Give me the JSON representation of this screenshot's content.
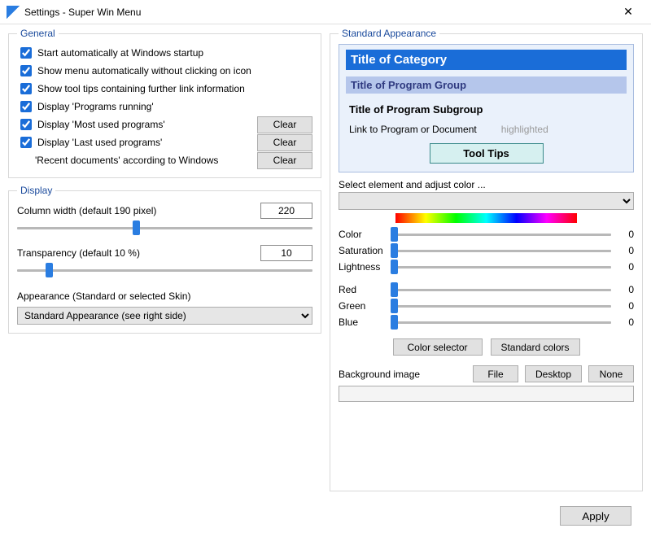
{
  "window": {
    "title": "Settings - Super Win Menu",
    "close": "✕"
  },
  "general": {
    "legend": "General",
    "items": [
      {
        "label": "Start automatically at Windows startup",
        "checked": true,
        "clear": false
      },
      {
        "label": "Show menu automatically without clicking on icon",
        "checked": true,
        "clear": false
      },
      {
        "label": "Show tool tips containing further link information",
        "checked": true,
        "clear": false
      },
      {
        "label": "Display 'Programs running'",
        "checked": true,
        "clear": false
      },
      {
        "label": "Display 'Most used programs'",
        "checked": true,
        "clear": true
      },
      {
        "label": "Display 'Last used programs'",
        "checked": true,
        "clear": true
      },
      {
        "label": "'Recent documents' according to Windows",
        "checked": null,
        "clear": true
      }
    ],
    "clear_label": "Clear"
  },
  "display": {
    "legend": "Display",
    "column_width_label": "Column width  (default 190 pixel)",
    "column_width_value": "220",
    "transparency_label": "Transparency  (default 10 %)",
    "transparency_value": "10",
    "appearance_label": "Appearance (Standard or selected Skin)",
    "appearance_value": "Standard Appearance (see right side)"
  },
  "standard": {
    "legend": "Standard Appearance",
    "preview": {
      "category": "Title of Category",
      "group": "Title of Program Group",
      "subgroup": "Title of Program Subgroup",
      "link": "Link to Program or Document",
      "highlighted": "highlighted",
      "tooltip": "Tool Tips"
    },
    "select_label": "Select element and adjust color ...",
    "select_value": "",
    "sliders": {
      "color": {
        "label": "Color",
        "value": "0"
      },
      "saturation": {
        "label": "Saturation",
        "value": "0"
      },
      "lightness": {
        "label": "Lightness",
        "value": "0"
      },
      "red": {
        "label": "Red",
        "value": "0"
      },
      "green": {
        "label": "Green",
        "value": "0"
      },
      "blue": {
        "label": "Blue",
        "value": "0"
      }
    },
    "color_selector": "Color selector",
    "standard_colors": "Standard colors",
    "background_label": "Background image",
    "file": "File",
    "desktop": "Desktop",
    "none": "None"
  },
  "apply": "Apply"
}
